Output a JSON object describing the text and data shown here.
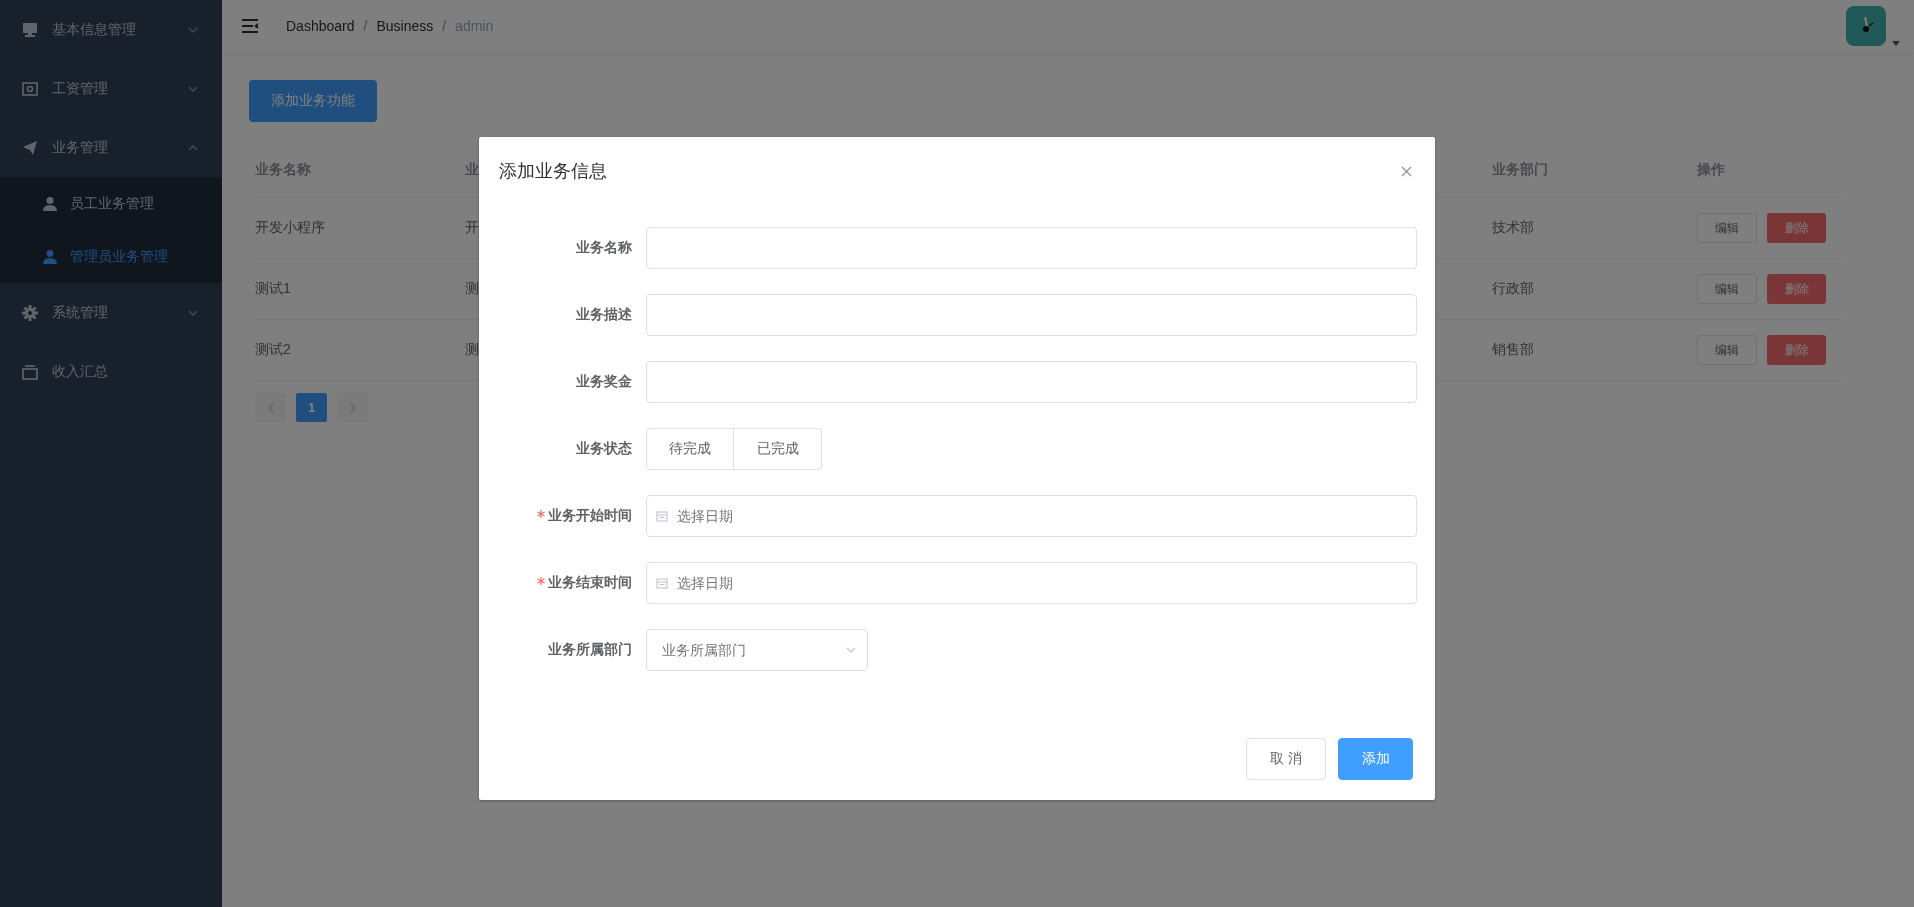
{
  "sidebar": {
    "items": [
      {
        "label": "基本信息管理",
        "expanded": false,
        "selected": false
      },
      {
        "label": "工资管理",
        "expanded": false,
        "selected": false
      },
      {
        "label": "业务管理",
        "expanded": true,
        "selected": false,
        "children": [
          {
            "label": "员工业务管理",
            "selected": false
          },
          {
            "label": "管理员业务管理",
            "selected": true
          }
        ]
      },
      {
        "label": "系统管理",
        "expanded": false,
        "selected": false
      },
      {
        "label": "收入汇总",
        "selected": false
      }
    ]
  },
  "header": {
    "breadcrumb": {
      "separator": "/",
      "items": [
        {
          "label": "Dashboard",
          "current": false
        },
        {
          "label": "Business",
          "current": false
        },
        {
          "label": "admin",
          "current": true
        }
      ]
    }
  },
  "toolbar": {
    "add_button": "添加业务功能"
  },
  "table": {
    "columns": [
      "业务名称",
      "业",
      "业务部门",
      "操作"
    ],
    "rows": [
      {
        "name": "开发小程序",
        "column_2": "开",
        "department": "技术部",
        "actions": [
          "编辑",
          "删除"
        ]
      },
      {
        "name": "测试1",
        "column_2": "测",
        "department": "行政部",
        "actions": [
          "编辑",
          "删除"
        ]
      },
      {
        "name": "测试2",
        "column_2": "测",
        "department": "销售部",
        "actions": [
          "编辑",
          "删除"
        ]
      }
    ]
  },
  "pagination": {
    "pages": [
      {
        "label": "1",
        "selected": true
      }
    ]
  },
  "dialog": {
    "title": "添加业务信息",
    "fields": [
      {
        "kind": "text",
        "label": "业务名称"
      },
      {
        "kind": "text",
        "label": "业务描述"
      },
      {
        "kind": "text",
        "label": "业务奖金"
      },
      {
        "kind": "radio",
        "label": "业务状态",
        "options": [
          {
            "label": "待完成",
            "selected": false
          },
          {
            "label": "已完成",
            "selected": false
          }
        ]
      },
      {
        "kind": "date",
        "label": "业务开始时间",
        "required": true,
        "placeholder": "选择日期"
      },
      {
        "kind": "date",
        "label": "业务结束时间",
        "required": true,
        "placeholder": "选择日期"
      },
      {
        "kind": "select",
        "label": "业务所属部门",
        "placeholder": "业务所属部门"
      }
    ],
    "buttons": [
      {
        "label": "取 消",
        "kind": "default"
      },
      {
        "label": "添加",
        "kind": "primary"
      }
    ]
  }
}
